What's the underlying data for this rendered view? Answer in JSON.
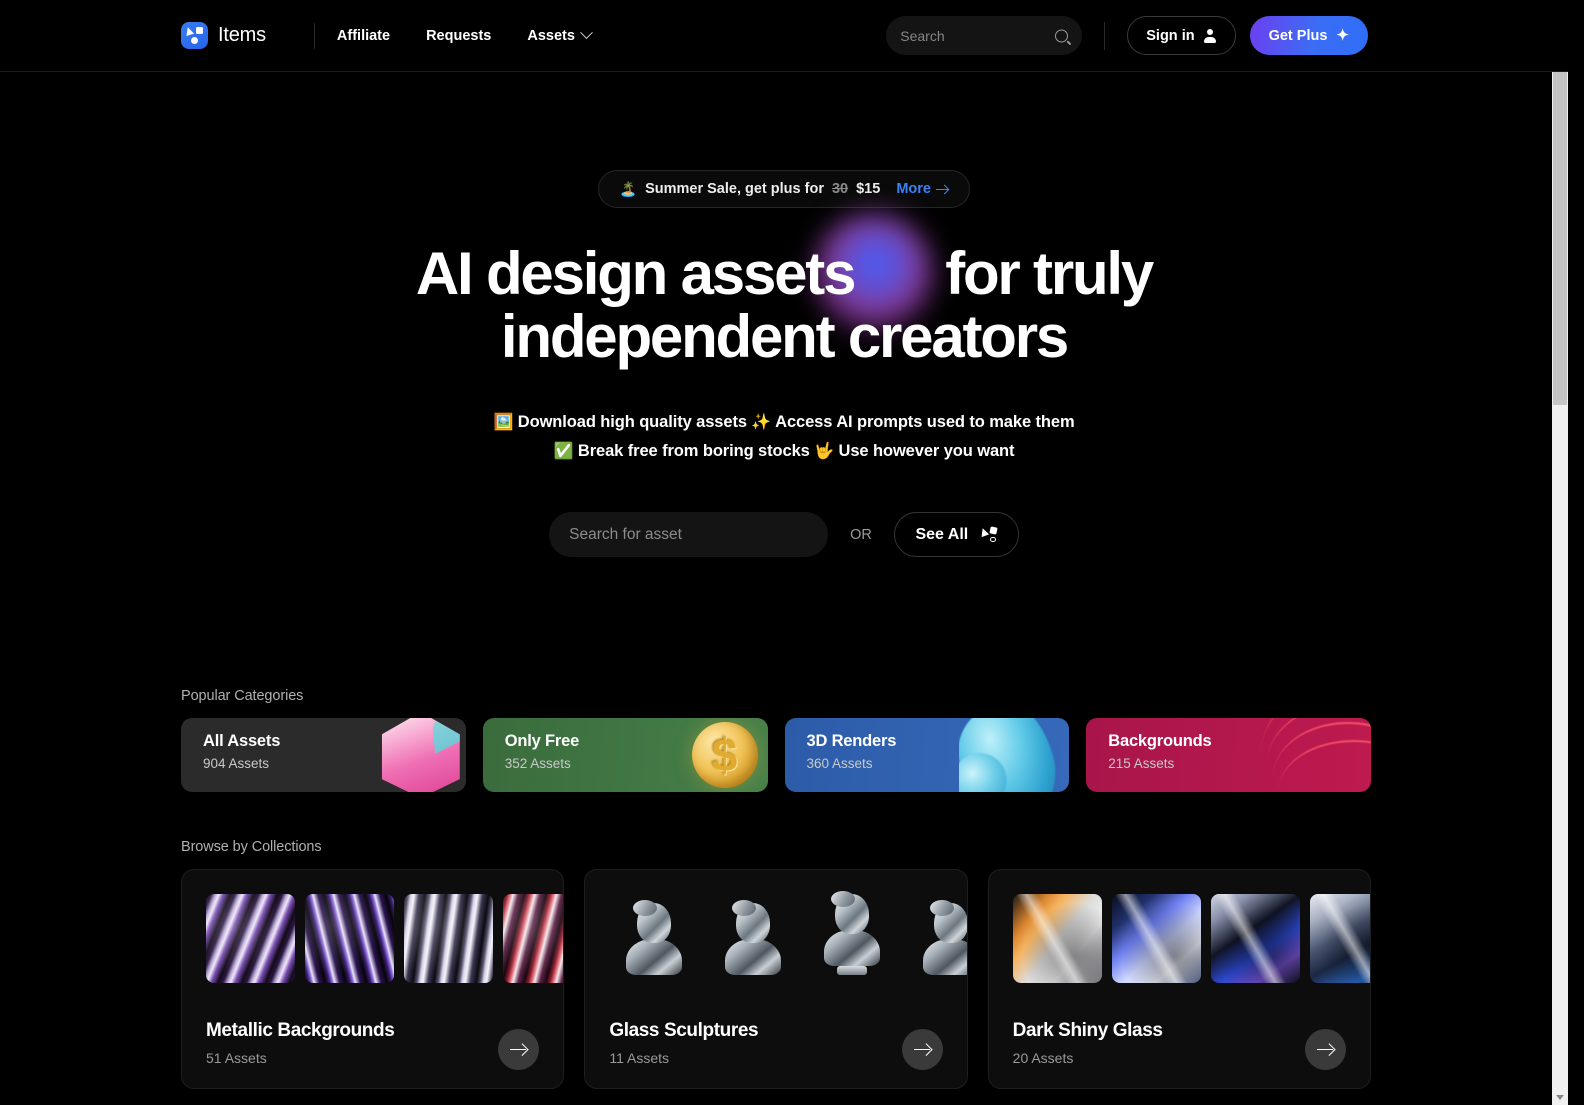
{
  "header": {
    "brand_name": "Items",
    "nav": [
      {
        "label": "Affiliate",
        "has_caret": false
      },
      {
        "label": "Requests",
        "has_caret": false
      },
      {
        "label": "Assets",
        "has_caret": true
      }
    ],
    "search_placeholder": "Search",
    "search_value": "",
    "sign_in_label": "Sign in",
    "get_plus_label": "Get Plus",
    "get_plus_icon": "sparkle-icon",
    "search_icon": "search-icon",
    "user_icon": "user-icon",
    "chevron_icon": "chevron-down-icon",
    "accent_blue": "#3b82f6",
    "plus_gradient_from": "#6d3ff0",
    "plus_gradient_to": "#2f6ef7"
  },
  "promo": {
    "emoji": "🏝️",
    "text": "Summer Sale, get plus for",
    "old_price": "30",
    "new_price": "$15",
    "cta_label": "More",
    "cta_icon": "arrow-right-icon"
  },
  "hero": {
    "headline_line1_a": "AI design assets",
    "headline_line1_b": "for truly",
    "headline_line2": "independent creators",
    "sub_line1_emoji1": "🖼️",
    "sub_line1_part1": "Download high quality assets",
    "sub_line1_emoji2": "✨",
    "sub_line1_part2": "Access AI prompts used to make them",
    "sub_line2_emoji1": "✅",
    "sub_line2_part1": "Break free from boring stocks",
    "sub_line2_emoji2": "🤟",
    "sub_line2_part2": "Use however you want",
    "search_placeholder": "Search for asset",
    "search_value": "",
    "or_label": "OR",
    "see_all_label": "See All",
    "see_all_icon": "shapes-icon"
  },
  "categories": {
    "section_label": "Popular Categories",
    "items": [
      {
        "title": "All Assets",
        "count": "904 Assets",
        "color": "#2b2b2b",
        "art": "pink-cube-icon"
      },
      {
        "title": "Only Free",
        "count": "352 Assets",
        "color": "#47814a",
        "art": "gold-coin-icon"
      },
      {
        "title": "3D Renders",
        "count": "360 Assets",
        "color": "#3769bb",
        "art": "blue-blob-icon"
      },
      {
        "title": "Backgrounds",
        "count": "215 Assets",
        "color": "#be1a4f",
        "art": "red-waves-icon"
      }
    ]
  },
  "collections": {
    "section_label": "Browse by Collections",
    "items": [
      {
        "title": "Metallic Backgrounds",
        "count": "51 Assets",
        "arrow_icon": "arrow-right-icon"
      },
      {
        "title": "Glass Sculptures",
        "count": "11 Assets",
        "arrow_icon": "arrow-right-icon"
      },
      {
        "title": "Dark Shiny Glass",
        "count": "20 Assets",
        "arrow_icon": "arrow-right-icon"
      }
    ]
  },
  "scrollbar": {
    "up_icon": "scroll-up-arrow-icon",
    "down_icon": "scroll-down-arrow-icon"
  }
}
